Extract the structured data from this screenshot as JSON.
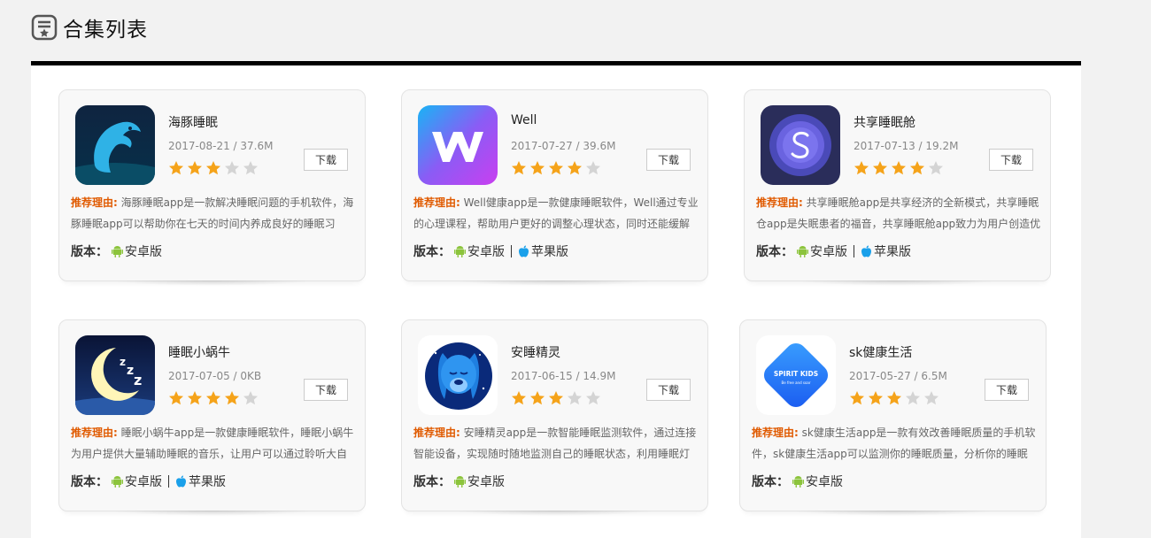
{
  "header": {
    "title": "合集列表"
  },
  "reason_label": "推荐理由:",
  "version_label": "版本：",
  "android_label": "安卓版",
  "ios_label": "苹果版",
  "download_label": "下载",
  "apps": [
    {
      "name": "海豚睡眠",
      "meta": "2017-08-21 / 37.6M",
      "rating": 3,
      "reason": "海豚睡眠app是一款解决睡眠问题的手机软件，海豚睡眠app可以帮助你在七天的时间内养成良好的睡眠习惯，",
      "platforms": [
        "android"
      ],
      "icon": "dolphin-icon"
    },
    {
      "name": "Well",
      "meta": "2017-07-27 / 39.6M",
      "rating": 4,
      "reason": "Well健康app是一款健康睡眠软件，Well通过专业的心理课程，帮助用户更好的调整心理状态，同时还能缓解用",
      "platforms": [
        "android",
        "ios"
      ],
      "icon": "well-w-icon"
    },
    {
      "name": "共享睡眠舱",
      "meta": "2017-07-13 / 19.2M",
      "rating": 4,
      "reason": "共享睡眠舱app是共享经济的全新模式，共享睡眠仓app是失眠患者的福音，共享睡眠舱app致力为用户创造优",
      "platforms": [
        "android",
        "ios"
      ],
      "icon": "s-circle-icon"
    },
    {
      "name": "睡眠小蜗牛",
      "meta": "2017-07-05 / 0KB",
      "rating": 4,
      "reason": "睡眠小蜗牛app是一款健康睡眠软件，睡眠小蜗牛为用户提供大量辅助睡眠的音乐，让用户可以通过聆听大自然",
      "platforms": [
        "android",
        "ios"
      ],
      "icon": "moon-zzz-icon"
    },
    {
      "name": "安睡精灵",
      "meta": "2017-06-15 / 14.9M",
      "rating": 3,
      "reason": "安睡精灵app是一款智能睡眠监测软件，通过连接智能设备，实现随时随地监测自己的睡眠状态，利用睡眠灯改",
      "platforms": [
        "android"
      ],
      "icon": "sleeping-dog-icon"
    },
    {
      "name": "sk健康生活",
      "meta": "2017-05-27 / 6.5M",
      "rating": 3,
      "reason": "sk健康生活app是一款有效改善睡眠质量的手机软件，sk健康生活app可以监测你的睡眠质量，分析你的睡眠状",
      "platforms": [
        "android"
      ],
      "icon": "spirit-kids-icon",
      "icon_text": "SPIRIT KIDS",
      "icon_subtext": "Be free and soar"
    }
  ]
}
